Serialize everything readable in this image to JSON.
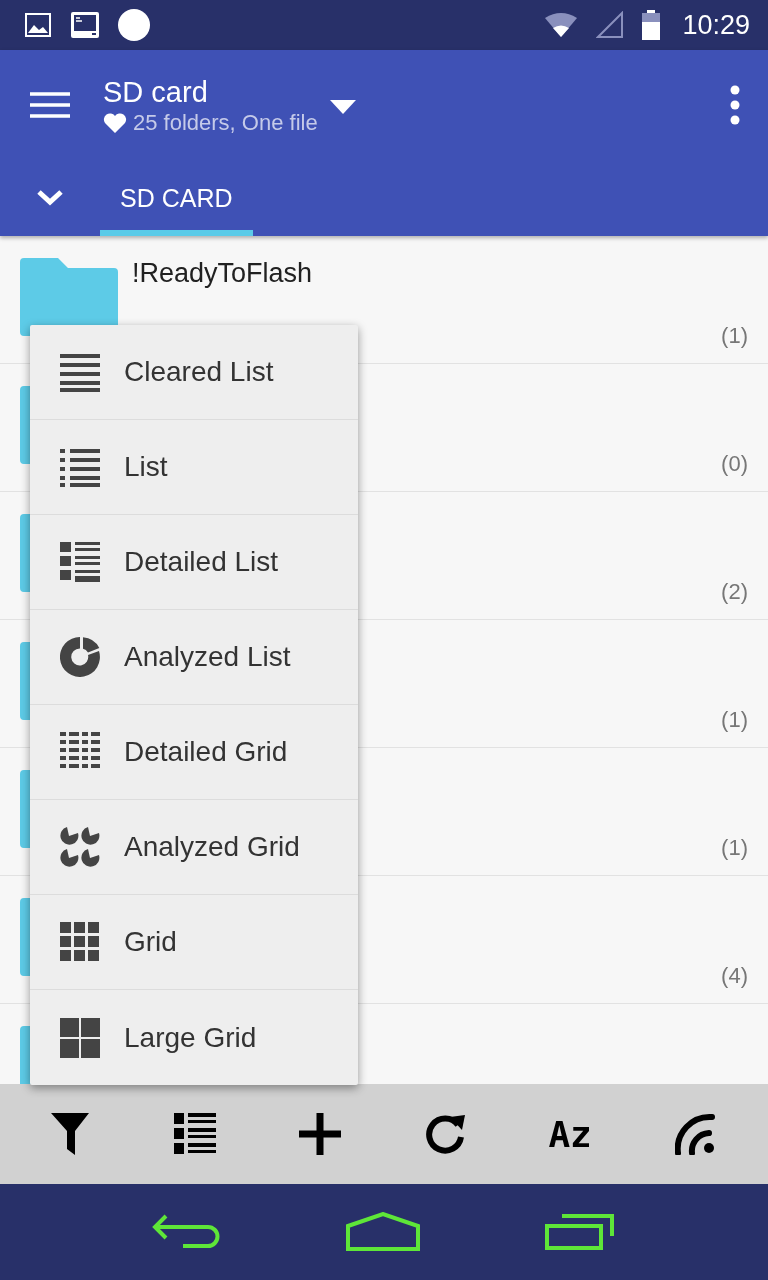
{
  "status_bar": {
    "time": "10:29"
  },
  "app_bar": {
    "title": "SD card",
    "subtitle": "25 folders, One file"
  },
  "tabs": [
    {
      "label": "SD CARD",
      "selected": true
    }
  ],
  "rows": [
    {
      "name": "!ReadyToFlash",
      "count": "(1)"
    },
    {
      "count": "(0)"
    },
    {
      "count": "(2)"
    },
    {
      "count": "(1)"
    },
    {
      "count": "(1)"
    },
    {
      "count": "(4)"
    },
    {}
  ],
  "view_menu": [
    {
      "label": "Cleared List"
    },
    {
      "label": "List"
    },
    {
      "label": "Detailed List"
    },
    {
      "label": "Analyzed List"
    },
    {
      "label": "Detailed Grid"
    },
    {
      "label": "Analyzed Grid"
    },
    {
      "label": "Grid"
    },
    {
      "label": "Large Grid"
    }
  ],
  "toolbar": {
    "sort_label": "Az"
  }
}
